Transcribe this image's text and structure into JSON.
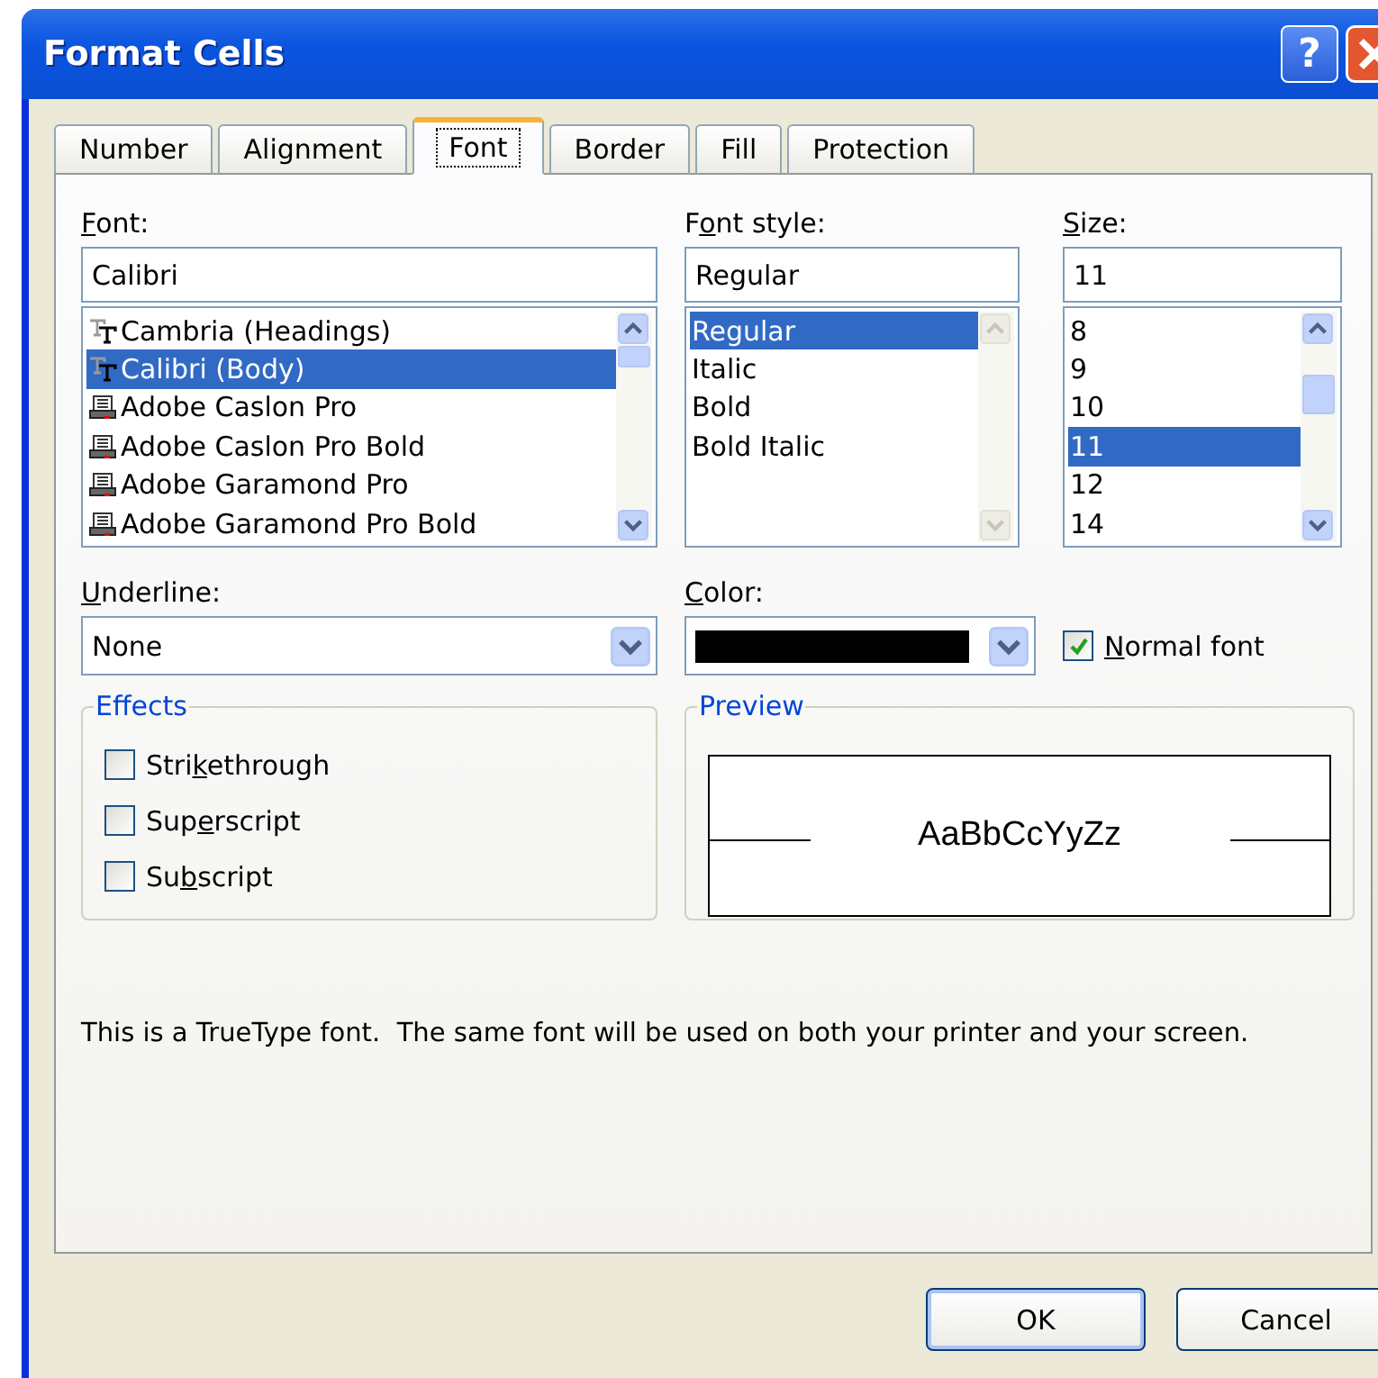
{
  "window": {
    "title": "Format Cells",
    "help_button": "?"
  },
  "tabs": [
    {
      "label": "Number",
      "selected": false
    },
    {
      "label": "Alignment",
      "selected": false
    },
    {
      "label": "Font",
      "selected": true
    },
    {
      "label": "Border",
      "selected": false
    },
    {
      "label": "Fill",
      "selected": false
    },
    {
      "label": "Protection",
      "selected": false
    }
  ],
  "font": {
    "label": {
      "key": "F",
      "post": "ont:"
    },
    "value": "Calibri",
    "scrollable": true,
    "items": [
      {
        "text": "Cambria (Headings)",
        "kind": "truetype",
        "selected": false
      },
      {
        "text": "Calibri (Body)",
        "kind": "truetype",
        "selected": true
      },
      {
        "text": "Adobe Caslon Pro",
        "kind": "printer",
        "selected": false
      },
      {
        "text": "Adobe Caslon Pro Bold",
        "kind": "printer",
        "selected": false
      },
      {
        "text": "Adobe Garamond Pro",
        "kind": "printer",
        "selected": false
      },
      {
        "text": "Adobe Garamond Pro Bold",
        "kind": "printer",
        "selected": false
      }
    ]
  },
  "font_style": {
    "label": {
      "pre": "F",
      "key": "o",
      "post": "nt style:"
    },
    "value": "Regular",
    "scrollable": false,
    "items": [
      {
        "text": "Regular",
        "selected": true
      },
      {
        "text": "Italic",
        "selected": false
      },
      {
        "text": "Bold",
        "selected": false
      },
      {
        "text": "Bold Italic",
        "selected": false
      }
    ]
  },
  "size": {
    "label": {
      "key": "S",
      "post": "ize:"
    },
    "value": "11",
    "scrollable": true,
    "items": [
      {
        "text": "8",
        "selected": false
      },
      {
        "text": "9",
        "selected": false
      },
      {
        "text": "10",
        "selected": false
      },
      {
        "text": "11",
        "selected": true
      },
      {
        "text": "12",
        "selected": false
      },
      {
        "text": "14",
        "selected": false
      }
    ]
  },
  "underline": {
    "label": {
      "key": "U",
      "post": "nderline:"
    },
    "value": "None"
  },
  "color": {
    "label": {
      "key": "C",
      "post": "olor:"
    },
    "color": "#000000"
  },
  "normal_font": {
    "label": {
      "key": "N",
      "post": "ormal font"
    },
    "checked": true
  },
  "effects": {
    "title": "Effects",
    "options": [
      {
        "label": {
          "pre": "Stri",
          "key": "k",
          "post": "ethrough"
        },
        "checked": false
      },
      {
        "label": {
          "pre": "Sup",
          "key": "e",
          "post": "rscript"
        },
        "checked": false
      },
      {
        "label": {
          "pre": "Su",
          "key": "b",
          "post": "script"
        },
        "checked": false
      }
    ]
  },
  "preview": {
    "title": "Preview",
    "sample": "AaBbCcYyZz"
  },
  "note": "This is a TrueType font.  The same font will be used on both your printer and your screen.",
  "buttons": [
    "OK",
    "Cancel"
  ]
}
